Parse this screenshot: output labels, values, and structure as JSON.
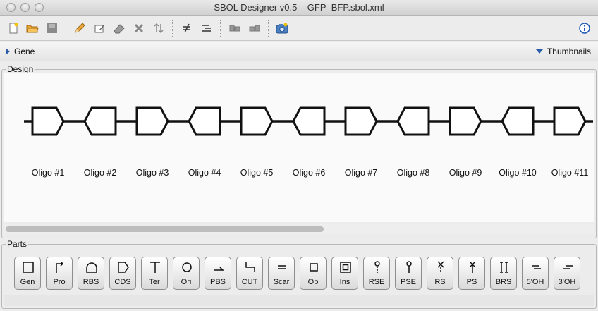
{
  "window": {
    "title": "SBOL Designer v0.5 – GFP–BFP.sbol.xml"
  },
  "toolbar": {
    "icons": [
      "new-file-icon",
      "open-folder-icon",
      "save-icon",
      "pencil-icon",
      "edit-part-icon",
      "eraser-icon",
      "delete-icon",
      "flip-icon",
      "strikethrough-icon",
      "list-icon",
      "focus-in-icon",
      "focus-out-icon",
      "snapshot-icon",
      "info-icon"
    ]
  },
  "gene_bar": {
    "gene_label": "Gene",
    "thumbnails_label": "Thumbnails"
  },
  "design": {
    "title": "Design",
    "oligos": [
      {
        "label": "Oligo #1",
        "direction": "forward"
      },
      {
        "label": "Oligo #2",
        "direction": "reverse"
      },
      {
        "label": "Oligo #3",
        "direction": "forward"
      },
      {
        "label": "Oligo #4",
        "direction": "reverse"
      },
      {
        "label": "Oligo #5",
        "direction": "forward"
      },
      {
        "label": "Oligo #6",
        "direction": "reverse"
      },
      {
        "label": "Oligo #7",
        "direction": "forward"
      },
      {
        "label": "Oligo #8",
        "direction": "reverse"
      },
      {
        "label": "Oligo #9",
        "direction": "forward"
      },
      {
        "label": "Oligo #10",
        "direction": "reverse"
      },
      {
        "label": "Oligo #11",
        "direction": "forward"
      }
    ]
  },
  "parts": {
    "title": "Parts",
    "items": [
      {
        "label": "Gen",
        "icon": "square-icon"
      },
      {
        "label": "Pro",
        "icon": "promoter-arrow-icon"
      },
      {
        "label": "RBS",
        "icon": "rbs-dome-icon"
      },
      {
        "label": "CDS",
        "icon": "cds-pentagon-icon"
      },
      {
        "label": "Ter",
        "icon": "terminator-t-icon"
      },
      {
        "label": "Ori",
        "icon": "origin-circle-icon"
      },
      {
        "label": "PBS",
        "icon": "pbs-half-arrow-icon"
      },
      {
        "label": "CUT",
        "icon": "cut-site-icon"
      },
      {
        "label": "Scar",
        "icon": "scar-lines-icon"
      },
      {
        "label": "Op",
        "icon": "operator-square-icon"
      },
      {
        "label": "Ins",
        "icon": "insulator-square-icon"
      },
      {
        "label": "RSE",
        "icon": "rse-lollipop-dotted-icon"
      },
      {
        "label": "PSE",
        "icon": "pse-lollipop-icon"
      },
      {
        "label": "RS",
        "icon": "rs-cross-icon"
      },
      {
        "label": "PS",
        "icon": "ps-cross-icon"
      },
      {
        "label": "BRS",
        "icon": "brs-brackets-icon"
      },
      {
        "label": "5'OH",
        "icon": "five-overhang-icon"
      },
      {
        "label": "3'OH",
        "icon": "three-overhang-icon"
      }
    ]
  }
}
